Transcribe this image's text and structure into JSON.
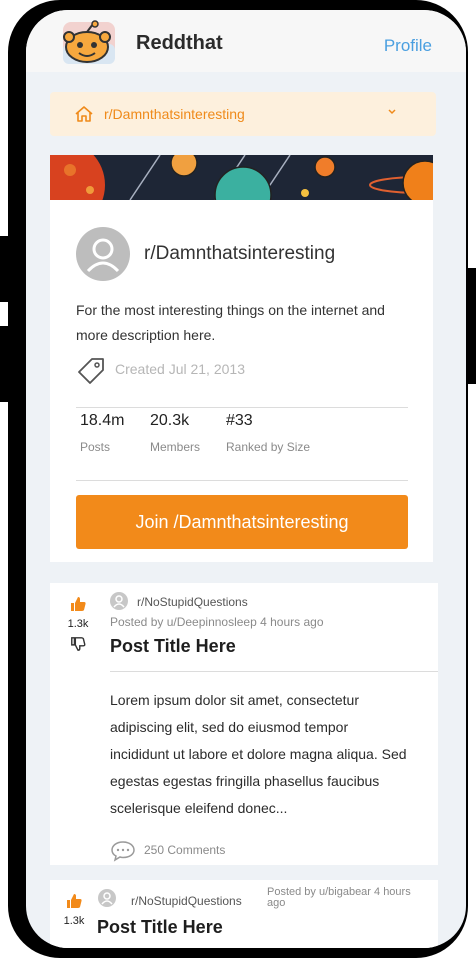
{
  "app": {
    "title": "Reddthat",
    "profile_label": "Profile"
  },
  "selector": {
    "label": "r/Damnthatsinteresting"
  },
  "subreddit": {
    "name": "r/Damnthatsinteresting",
    "description": "For the most interesting things on the internet and more description here.",
    "created": "Created Jul 21, 2013",
    "stats": [
      {
        "value": "18.4m",
        "label": "Posts"
      },
      {
        "value": "20.3k",
        "label": "Members"
      },
      {
        "value": "#33",
        "label": "Ranked by Size"
      }
    ],
    "join_label": "Join /Damnthatsinteresting"
  },
  "posts": [
    {
      "votes": "1.3k",
      "subreddit": "r/NoStupidQuestions",
      "meta": "Posted by u/Deepinnosleep 4 hours ago",
      "title": "Post Title Here",
      "body": "Lorem ipsum dolor sit amet, consectetur adipiscing elit, sed do eiusmod tempor incididunt ut labore et dolore magna aliqua. Sed egestas egestas fringilla phasellus faucibus scelerisque eleifend donec...",
      "comments": "250 Comments"
    },
    {
      "votes": "1.3k",
      "subreddit": "r/NoStupidQuestions",
      "meta": "Posted by u/bigabear 4 hours ago",
      "title": "Post Title Here"
    }
  ],
  "colors": {
    "accent": "#f28a1a",
    "link": "#4a9fe0",
    "background": "#eef2f6"
  }
}
